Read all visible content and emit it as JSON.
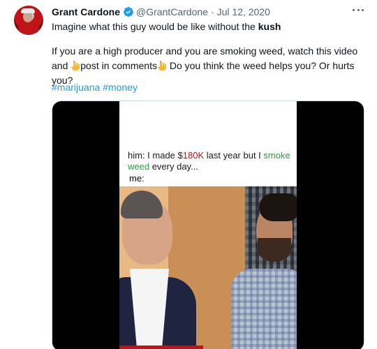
{
  "tweet": {
    "author_name": "Grant Cardone",
    "handle": "@GrantCardone",
    "separator": "·",
    "date": "Jul 12, 2020",
    "line1_prefix": "Imagine what this guy would be like without the ",
    "line1_bold": "kush",
    "para2_part1": "If you are a high producer and you are smoking weed, watch this video and ",
    "para2_part2": "post in comments",
    "para2_part3": " Do you think the weed helps you? Or hurts you?",
    "hashtag1": "#marijuana",
    "hashtag2": "#money"
  },
  "media": {
    "caption_part1": "him: I made $",
    "caption_money": "180K",
    "caption_part2": " last year but I ",
    "caption_weed": "smoke weed",
    "caption_part3": " every day...",
    "me_label": "me:"
  },
  "icons": {
    "verified": "verified-badge-icon",
    "more": "more-options-icon",
    "emoji": "pointing-down-emoji"
  },
  "colors": {
    "link": "#1d9bf0",
    "verified": "#1d9bf0",
    "money_text": "#c0141b",
    "weed_text": "#2f9e44"
  }
}
